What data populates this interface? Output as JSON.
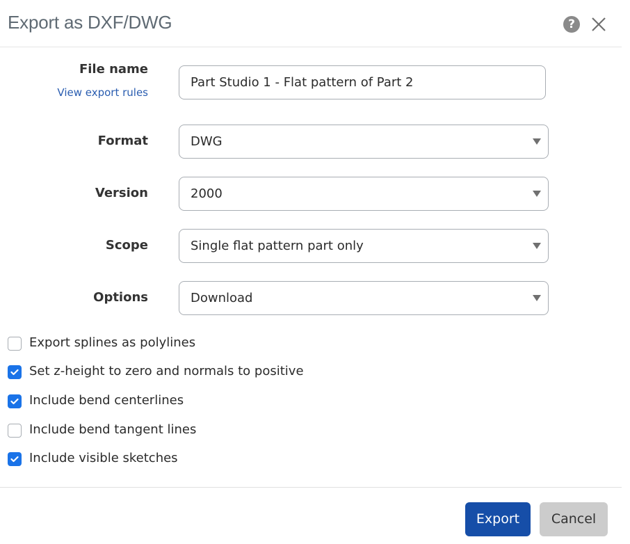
{
  "dialog": {
    "title": "Export as DXF/DWG",
    "help_icon": "help-circle-icon",
    "close_icon": "close-icon"
  },
  "form": {
    "file_name": {
      "label": "File name",
      "link": "View export rules",
      "value": "Part Studio 1 - Flat pattern of Part 2"
    },
    "format": {
      "label": "Format",
      "value": "DWG"
    },
    "version": {
      "label": "Version",
      "value": "2000"
    },
    "scope": {
      "label": "Scope",
      "value": "Single flat pattern part only"
    },
    "options": {
      "label": "Options",
      "value": "Download"
    }
  },
  "checkboxes": [
    {
      "label": "Export splines as polylines",
      "checked": false
    },
    {
      "label": "Set z-height to zero and normals to positive",
      "checked": true
    },
    {
      "label": "Include bend centerlines",
      "checked": true
    },
    {
      "label": "Include bend tangent lines",
      "checked": false
    },
    {
      "label": "Include visible sketches",
      "checked": true
    }
  ],
  "footer": {
    "export_label": "Export",
    "cancel_label": "Cancel"
  },
  "colors": {
    "primary": "#164ea8",
    "checkbox_checked": "#1a73e8",
    "link": "#2a5db0",
    "cancel_bg": "#cccccc"
  }
}
